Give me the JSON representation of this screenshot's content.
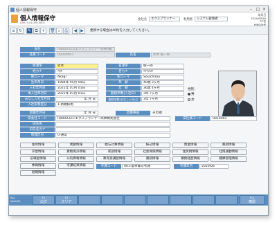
{
  "window": {
    "title": "個人情報保守",
    "minimize": "–",
    "maximize": "□",
    "close": "×"
  },
  "header": {
    "title": "個人情報保守",
    "version": "(Ver. 5.01.00U.00G)",
    "company_label": "会社名",
    "company_value": "エクスプランナー",
    "user_label": "利用者",
    "user_value": "システム管理者",
    "meta_line1": "年月日",
    "meta_line2": "2024/08/16",
    "meta_line3": "PC名",
    "meta_line4": "HINOSHP"
  },
  "toolbar": {
    "message": "更新する場合は40桁を入力してください。"
  },
  "form": {
    "company_label": "会社",
    "company_value": "H0000321/エクスプランナー商事(株)",
    "employee_code_label": "社員コード",
    "employee_code_value": "00000001",
    "name_label": "氏名",
    "name_value": "赤木 総一郎",
    "surname_kanji_label": "姓漢字",
    "surname_kanji_value": "赤木",
    "surname_kana_label": "姓カナ",
    "surname_kana_value": "ｱｶｷﾞ",
    "surname_roman_label": "姓ローマ",
    "surname_roman_value": "Akagi",
    "given_kanji_label": "名漢字",
    "given_kanji_value": "総一郎",
    "given_kana_label": "名カナ",
    "given_kana_value": "ｿｳｲﾁﾛｳ",
    "given_roman_label": "名ローマ",
    "given_roman_value": "Souichirou",
    "birth_label": "生年月日",
    "birth_value": "1984年 05月 04日",
    "join_label": "入社年月日",
    "join_value": "2021年 01月 01日",
    "main_join_label": "本入社年月日",
    "main_join_value": "2021年 01月 01日",
    "deemed_join_label": "みなし入社年月日",
    "deemed_join_value": "年 月 日",
    "join_type_label": "入社形態区分",
    "join_type_value": "1:新規採用",
    "age_label": "年　齢",
    "age_value": "40歳 3ヶ月",
    "age2_label": "年　齢",
    "age2_value": "36歳 4ヶ月",
    "service_label": "勤続年数(入社日)",
    "service_value": "3年 7ヶ月",
    "service2_label": "勤続年数(みなし入社日)",
    "service2_value": "3年 7ヶ月",
    "gender_label": "性別",
    "gender_male": "男",
    "gender_female": "女",
    "retire_label": "退職年月日",
    "retire_value": "年 月 日",
    "retire_reason_label": "退職事由",
    "retire_reason_value": "その他",
    "old_company_label": "旧会社コード",
    "old_company_value": "H0000321:エクスプランナー商事株式会社",
    "old_emp_label": "旧社員コード",
    "old_emp_value": "0010001",
    "old_name_label": "旧氏名",
    "old_name_kana_label": "旧氏名カナ",
    "admin_label": "管理区分",
    "admin_value": "0:通常"
  },
  "buttons": {
    "row1": [
      "住所情報",
      "異動情報",
      "給与計算情報",
      "振込情報",
      "資金情報",
      "賞罰情報"
    ],
    "row2": [
      "学歴情報",
      "資格免許情報",
      "家族情報",
      "社会保険情報",
      "住民税情報",
      "社用通勤情報"
    ],
    "row3": [
      "前職歴情報",
      "公的資格情報",
      "教育受講歴情報",
      "賞罰情報",
      "業務経歴情報",
      "健康管理情報"
    ],
    "row4": [
      "休職情報"
    ],
    "row5": [
      "退職情報"
    ]
  },
  "eval": {
    "result_label": "考課結果情報",
    "code_label": "考課コード",
    "code_value": "001:夏季賞与考課",
    "year_label": "考課年月",
    "year_value": "2020/06"
  },
  "fkeys": {
    "esc_line1": "Esc",
    "esc_line2": "Quit/Ok",
    "f1_key": "F1",
    "f1_label": "ログ",
    "f2_key": "F2",
    "f2_label": "クリア",
    "f12_key": "F12",
    "f12_label": "確認"
  }
}
